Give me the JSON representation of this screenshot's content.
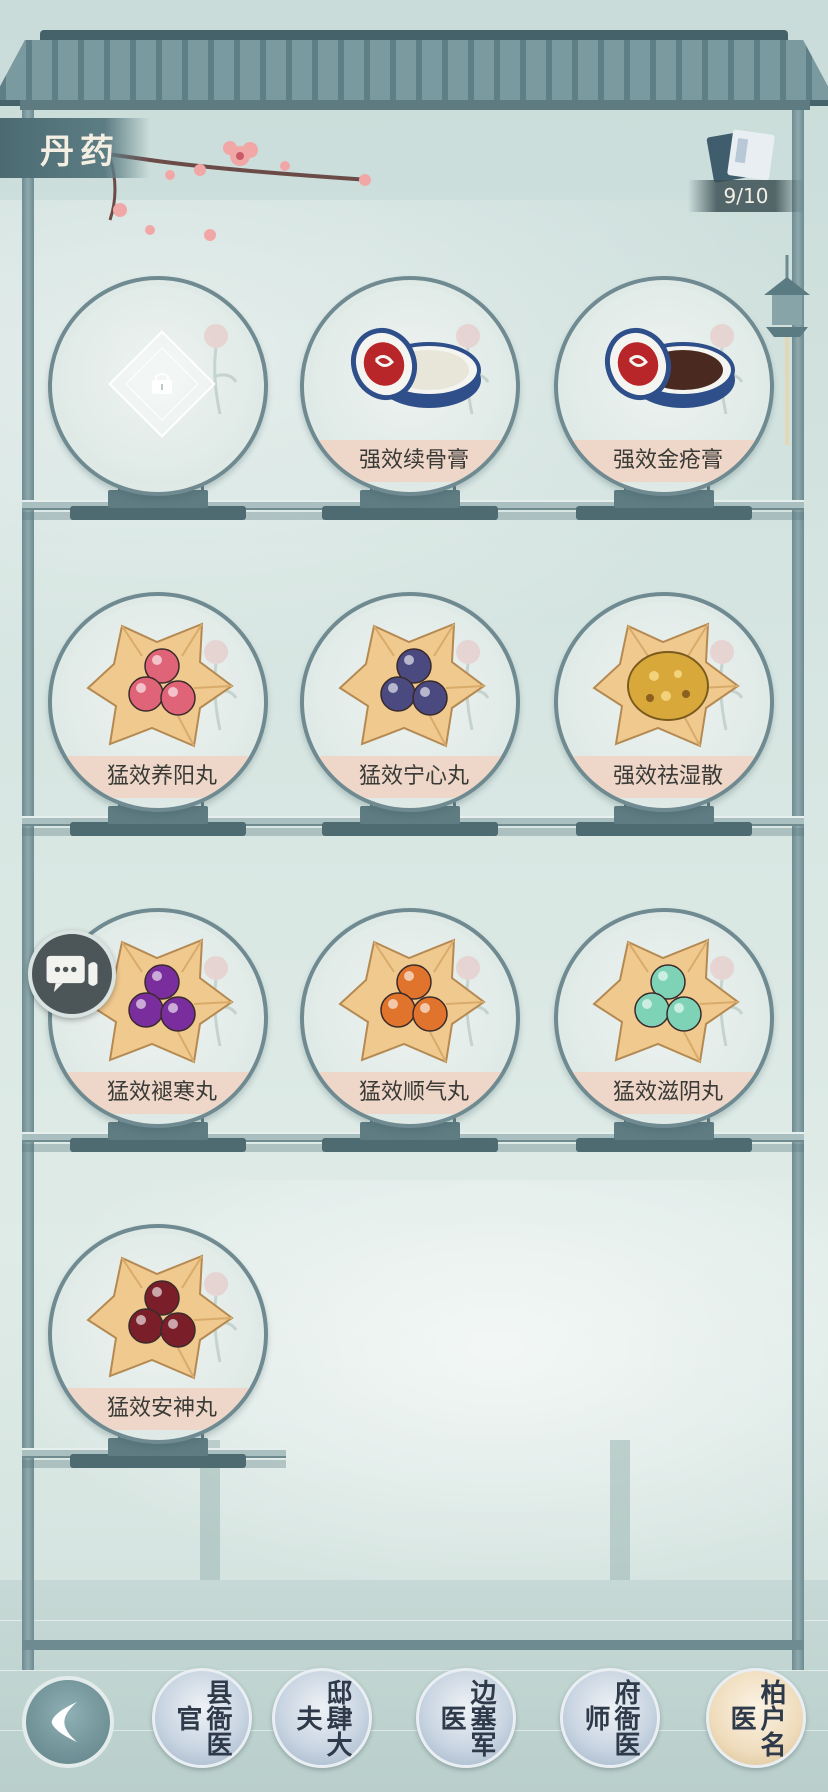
{
  "title": "丹药",
  "counter": "9/10",
  "rows": [
    [
      {
        "name": "",
        "empty": true
      },
      {
        "name": "强效续骨膏",
        "art": "jar-white"
      },
      {
        "name": "强效金疮膏",
        "art": "jar-dark"
      }
    ],
    [
      {
        "name": "猛效养阳丸",
        "art": "pills",
        "color": "#e06478"
      },
      {
        "name": "猛效宁心丸",
        "art": "pills",
        "color": "#4a4a80"
      },
      {
        "name": "强效祛湿散",
        "art": "powder",
        "color": "#d9a83a"
      }
    ],
    [
      {
        "name": "猛效褪寒丸",
        "art": "pills",
        "color": "#7a2e9e"
      },
      {
        "name": "猛效顺气丸",
        "art": "pills",
        "color": "#e0742c"
      },
      {
        "name": "猛效滋阴丸",
        "art": "pills",
        "color": "#7ed2b6"
      }
    ],
    [
      {
        "name": "猛效安神丸",
        "art": "pills",
        "color": "#7a1f2a"
      }
    ]
  ],
  "nav": [
    {
      "label": "县衙医官",
      "active": false
    },
    {
      "label": "邸肆大夫",
      "active": false
    },
    {
      "label": "边塞军医",
      "active": false
    },
    {
      "label": "府衙医师",
      "active": false
    },
    {
      "label": "柏户名医",
      "active": true
    }
  ]
}
